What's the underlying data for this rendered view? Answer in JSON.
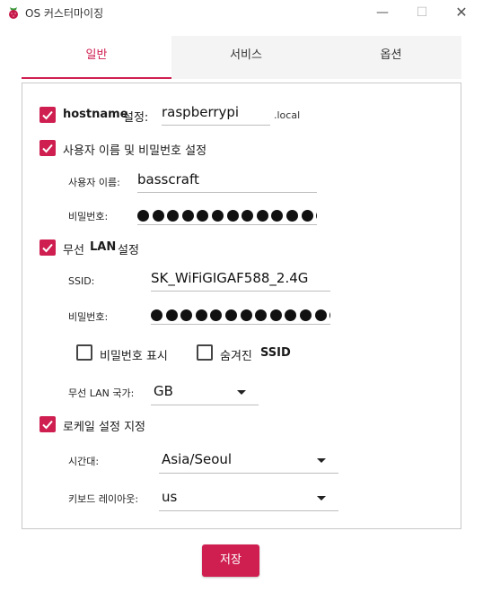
{
  "window": {
    "title": "OS 커스터마이징",
    "min_icon": "minimize-icon",
    "max_icon": "maximize-icon",
    "close_icon": "close-icon"
  },
  "tabs": [
    {
      "label": "일반",
      "active": true
    },
    {
      "label": "서비스",
      "active": false
    },
    {
      "label": "옵션",
      "active": false
    }
  ],
  "general": {
    "hostname": {
      "checked": true,
      "label_bold": "hostname",
      "label": "설정:",
      "value": "raspberrypi",
      "suffix": ".local"
    },
    "user": {
      "checked": true,
      "label": "사용자 이름 및 비밀번호 설정",
      "username_label": "사용자 이름:",
      "username_value": "basscraft",
      "password_label": "비밀번호:",
      "password_mask_count": 13
    },
    "wifi": {
      "checked": true,
      "label_prefix": "무선",
      "label_bold": "LAN",
      "label_suffix": "설정",
      "ssid_label": "SSID:",
      "ssid_value": "SK_WiFiGIGAF588_2.4G",
      "password_label": "비밀번호:",
      "password_mask_count": 13,
      "show_password": {
        "checked": false,
        "label": "비밀번호 표시"
      },
      "hidden_ssid": {
        "checked": false,
        "label_prefix": "숨겨진",
        "label_bold": "SSID"
      },
      "country_label": "무선 LAN 국가:",
      "country_value": "GB"
    },
    "locale": {
      "checked": true,
      "label": "로케일 설정 지정",
      "timezone_label": "시간대:",
      "timezone_value": "Asia/Seoul",
      "keyboard_label": "키보드 레이아웃:",
      "keyboard_value": "us"
    }
  },
  "save_button": "저장",
  "colors": {
    "accent": "#cf1f51",
    "checkbox_checked": "#cf1f51"
  }
}
